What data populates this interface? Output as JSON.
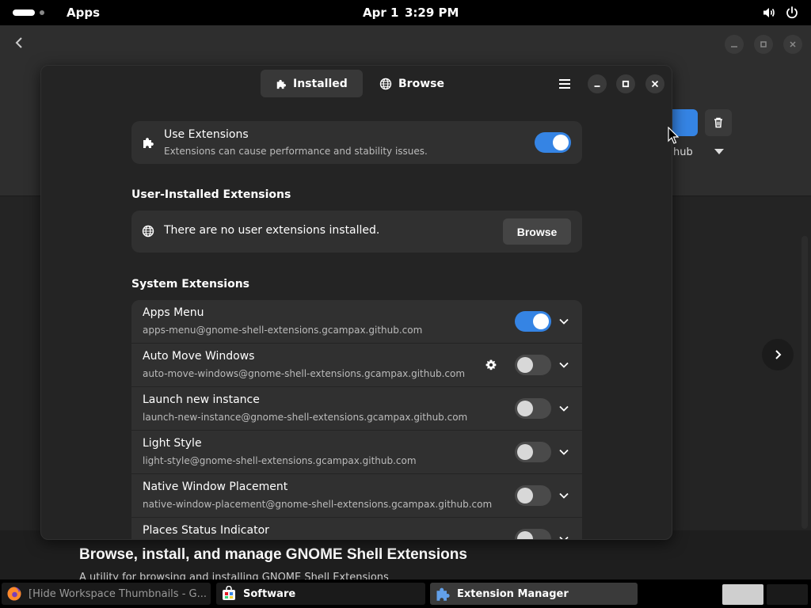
{
  "topbar": {
    "activities_label": "Apps",
    "date": "Apr 1",
    "time": "3:29 PM"
  },
  "background_app": {
    "partial_label": "hub",
    "title": "Browse, install, and manage GNOME Shell Extensions",
    "subtitle": "A utility for browsing and installing GNOME Shell Extensions"
  },
  "window": {
    "tabs": [
      {
        "label": "Installed",
        "icon": "puzzle-icon",
        "active": true
      },
      {
        "label": "Browse",
        "icon": "globe-icon",
        "active": false
      }
    ],
    "use_extensions": {
      "title": "Use Extensions",
      "subtitle": "Extensions can cause performance and stability issues.",
      "enabled": true
    },
    "user_section": {
      "title": "User-Installed Extensions",
      "empty_message": "There are no user extensions installed.",
      "browse_label": "Browse"
    },
    "system_section": {
      "title": "System Extensions",
      "extensions": [
        {
          "name": "Apps Menu",
          "uuid": "apps-menu@gnome-shell-extensions.gcampax.github.com",
          "enabled": true,
          "has_settings": false
        },
        {
          "name": "Auto Move Windows",
          "uuid": "auto-move-windows@gnome-shell-extensions.gcampax.github.com",
          "enabled": false,
          "has_settings": true
        },
        {
          "name": "Launch new instance",
          "uuid": "launch-new-instance@gnome-shell-extensions.gcampax.github.com",
          "enabled": false,
          "has_settings": false
        },
        {
          "name": "Light Style",
          "uuid": "light-style@gnome-shell-extensions.gcampax.github.com",
          "enabled": false,
          "has_settings": false
        },
        {
          "name": "Native Window Placement",
          "uuid": "native-window-placement@gnome-shell-extensions.gcampax.github.com",
          "enabled": false,
          "has_settings": false
        },
        {
          "name": "Places Status Indicator",
          "uuid": "",
          "enabled": false,
          "has_settings": false
        }
      ]
    }
  },
  "taskbar": {
    "tasks": [
      {
        "label": "[Hide Workspace Thumbnails - G...",
        "icon": "firefox-icon"
      },
      {
        "label": "Software",
        "icon": "software-icon"
      },
      {
        "label": "Extension Manager",
        "icon": "puzzle-icon"
      }
    ]
  },
  "colors": {
    "accent": "#3584e4",
    "window_bg": "#242424",
    "card_bg": "#303030",
    "topbar_bg": "#000000"
  }
}
